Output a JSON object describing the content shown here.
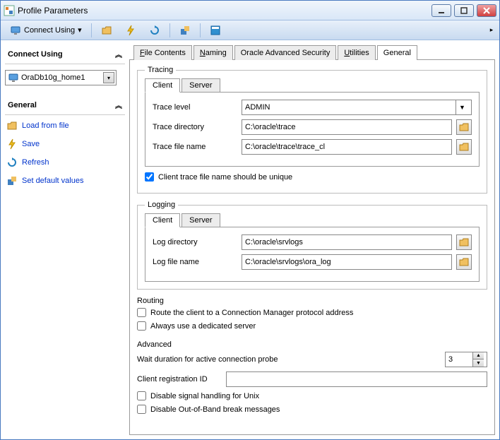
{
  "window": {
    "title": "Profile Parameters"
  },
  "toolbar": {
    "connect_label": "Connect Using"
  },
  "sidebar": {
    "connect_header": "Connect Using",
    "combo_value": "OraDb10g_home1",
    "general_header": "General",
    "items": [
      {
        "label": "Load from file"
      },
      {
        "label": "Save"
      },
      {
        "label": "Refresh"
      },
      {
        "label": "Set default values"
      }
    ]
  },
  "tabs": {
    "file_contents": "File Contents",
    "naming": "Naming",
    "oas": "Oracle Advanced Security",
    "utilities": "Utilities",
    "general": "General"
  },
  "tracing": {
    "legend": "Tracing",
    "tab_client": "Client",
    "tab_server": "Server",
    "trace_level_label": "Trace level",
    "trace_level_value": "ADMIN",
    "trace_dir_label": "Trace directory",
    "trace_dir_value": "C:\\oracle\\trace",
    "trace_file_label": "Trace file name",
    "trace_file_value": "C:\\oracle\\trace\\trace_cl",
    "unique_label": "Client trace file name should be unique"
  },
  "logging": {
    "legend": "Logging",
    "tab_client": "Client",
    "tab_server": "Server",
    "log_dir_label": "Log directory",
    "log_dir_value": "C:\\oracle\\srvlogs",
    "log_file_label": "Log file name",
    "log_file_value": "C:\\oracle\\srvlogs\\ora_log"
  },
  "routing": {
    "legend": "Routing",
    "route_cm_label": "Route the client to a Connection Manager protocol address",
    "dedicated_label": "Always use a dedicated server"
  },
  "advanced": {
    "legend": "Advanced",
    "wait_label": "Wait duration for active connection probe",
    "wait_value": "3",
    "regid_label": "Client registration ID",
    "regid_value": "",
    "disable_signal_label": "Disable signal handling for Unix",
    "disable_oob_label": "Disable Out-of-Band break messages"
  }
}
